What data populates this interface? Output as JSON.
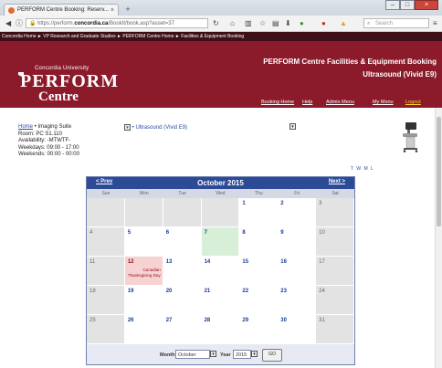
{
  "browser": {
    "tab_title": "PERFORM Centre Booking: Reserv...",
    "tab_close": "×",
    "new_tab": "+",
    "url_prefix": "https://perform.",
    "url_domain": "concordia.ca",
    "url_path": "/BookIt/book.asp?asset=37",
    "search_placeholder": "Search",
    "win_min": "–",
    "win_max": "□",
    "win_close": "×"
  },
  "breadcrumb": "Concordia Home  ►  VP Research and Graduate Studies  ►  PERFORM Centre Home  ►  Facilities & Equipment Booking",
  "header": {
    "university": "Concordia University",
    "brand": "PERFORM",
    "brand_sub": "Centre",
    "title": "PERFORM Centre Facilities & Equipment Booking",
    "subtitle": "Ultrasound (Vivid E9)",
    "nav": [
      "Booking Home",
      "Help",
      "Admin Menu",
      "My Menu",
      "Logout"
    ]
  },
  "info": {
    "home_link": "Home",
    "suite": "Imaging Suite",
    "room": "Room: PC S1.110",
    "availability": "Availability: -MTWTF-",
    "weekdays": "Weekdays: 09:00 - 17:00",
    "weekends": "Weekends: 00:00 - 00:00",
    "resource": "Ultrasound (Vivid E9)",
    "view_icons": "T W M L"
  },
  "calendar": {
    "prev": "< Prev",
    "next": "Next >",
    "month_title": "October 2015",
    "dows": [
      "Sun",
      "Mon",
      "Tue",
      "Wed",
      "Thu",
      "Fri",
      "Sat"
    ],
    "days": [
      "",
      "",
      "",
      "",
      "1",
      "2",
      "3",
      "4",
      "5",
      "6",
      "7",
      "8",
      "9",
      "10",
      "11",
      "12",
      "13",
      "14",
      "15",
      "16",
      "17",
      "18",
      "19",
      "20",
      "21",
      "22",
      "23",
      "24",
      "25",
      "26",
      "27",
      "28",
      "29",
      "30",
      "31"
    ],
    "event_day": "12",
    "event_text": "Canadian Thanksgiving Day",
    "today": "7",
    "month_label": "Month",
    "month_value": "October",
    "year_label": "Year",
    "year_value": "2015",
    "go": "GO"
  },
  "colors": {
    "brand": "#8b1a2b",
    "calendar_header": "#2d4a96"
  }
}
